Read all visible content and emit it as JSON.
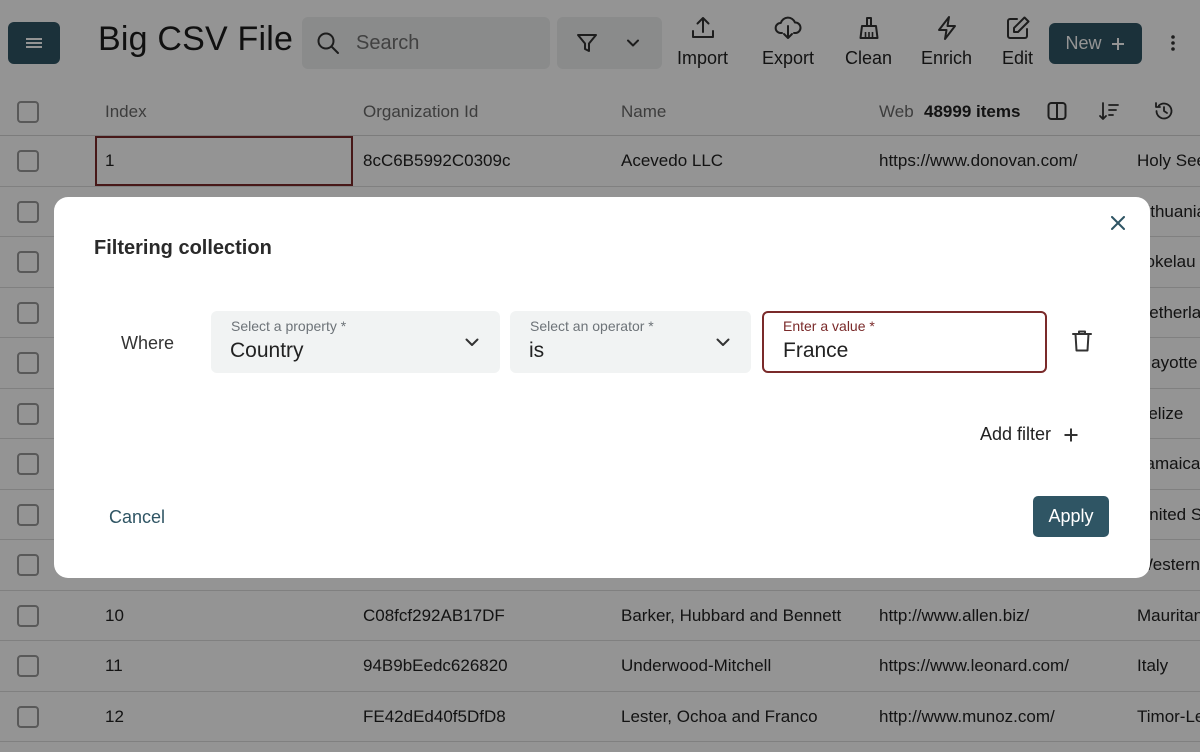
{
  "app": {
    "title": "Big CSV File"
  },
  "toolbar": {
    "search_placeholder": "Search",
    "tools": [
      {
        "label": "Import",
        "icon": "upload-icon"
      },
      {
        "label": "Export",
        "icon": "cloud-download-icon"
      },
      {
        "label": "Clean",
        "icon": "broom-icon"
      },
      {
        "label": "Enrich",
        "icon": "lightning-icon"
      },
      {
        "label": "Edit",
        "icon": "edit-icon"
      }
    ],
    "new_label": "New"
  },
  "table": {
    "headers": [
      "Index",
      "Organization Id",
      "Name",
      "Web"
    ],
    "item_count": "48999 items",
    "rows": [
      {
        "index": "1",
        "org_id": "8cC6B5992C0309c",
        "name": "Acevedo LLC",
        "web": "https://www.donovan.com/",
        "country": "Holy See"
      },
      {
        "index": "",
        "org_id": "",
        "name": "",
        "web": "",
        "country": "Lithuania"
      },
      {
        "index": "",
        "org_id": "",
        "name": "",
        "web": "",
        "country": "Tokelau"
      },
      {
        "index": "",
        "org_id": "",
        "name": "",
        "web": "",
        "country": "Netherlands"
      },
      {
        "index": "",
        "org_id": "",
        "name": "",
        "web": "",
        "country": "Mayotte"
      },
      {
        "index": "",
        "org_id": "",
        "name": "",
        "web": "",
        "country": "Belize"
      },
      {
        "index": "",
        "org_id": "",
        "name": "",
        "web": "",
        "country": "Jamaica"
      },
      {
        "index": "",
        "org_id": "",
        "name": "",
        "web": "",
        "country": "United S"
      },
      {
        "index": "",
        "org_id": "",
        "name": "",
        "web": "",
        "country": "Western"
      },
      {
        "index": "10",
        "org_id": "C08fcf292AB17DF",
        "name": "Barker, Hubbard and Bennett",
        "web": "http://www.allen.biz/",
        "country": "Mauritania"
      },
      {
        "index": "11",
        "org_id": "94B9bEedc626820",
        "name": "Underwood-Mitchell",
        "web": "https://www.leonard.com/",
        "country": "Italy"
      },
      {
        "index": "12",
        "org_id": "FE42dEd40f5DfD8",
        "name": "Lester, Ochoa and Franco",
        "web": "http://www.munoz.com/",
        "country": "Timor-Leste"
      }
    ]
  },
  "modal": {
    "title": "Filtering collection",
    "where_label": "Where",
    "property_label": "Select a property *",
    "property_value": "Country",
    "operator_label": "Select an operator *",
    "operator_value": "is",
    "value_label": "Enter a value *",
    "value_value": "France",
    "add_filter_label": "Add filter",
    "cancel_label": "Cancel",
    "apply_label": "Apply"
  },
  "colors": {
    "primary": "#2f5564",
    "focus_border": "#7a2a2a",
    "field_bg": "#f1f3f3"
  }
}
